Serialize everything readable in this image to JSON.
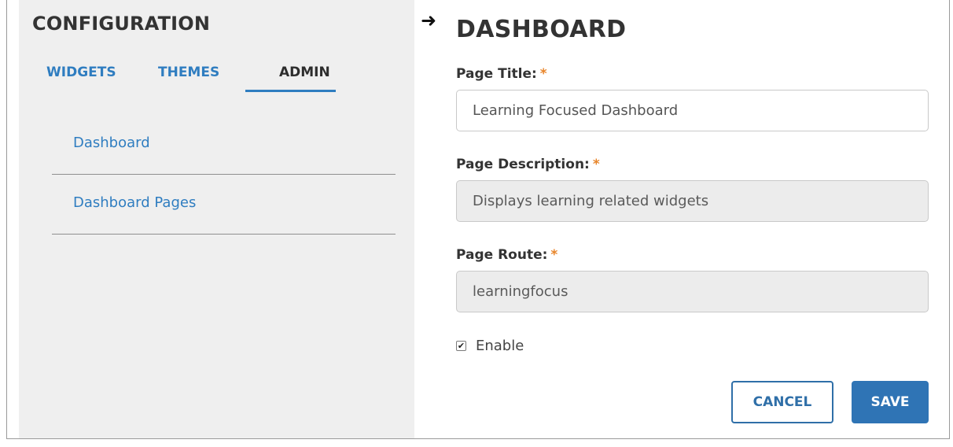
{
  "sidebar": {
    "title": "CONFIGURATION",
    "tabs": [
      {
        "label": "WIDGETS",
        "active": false
      },
      {
        "label": "THEMES",
        "active": false
      },
      {
        "label": "ADMIN",
        "active": true
      }
    ],
    "items": [
      {
        "label": "Dashboard"
      },
      {
        "label": "Dashboard Pages"
      }
    ]
  },
  "main": {
    "arrow_icon": "right-arrow-icon",
    "title": "DASHBOARD",
    "required_marker": "*",
    "fields": {
      "page_title": {
        "label": "Page Title:",
        "value": "Learning Focused Dashboard"
      },
      "page_description": {
        "label": "Page Description:",
        "value": "Displays learning related widgets"
      },
      "page_route": {
        "label": "Page Route:",
        "value": "learningfocus"
      }
    },
    "enable": {
      "label": "Enable",
      "checked": true
    },
    "buttons": {
      "cancel_label": "CANCEL",
      "save_label": "SAVE"
    }
  },
  "colors": {
    "accent": "#2f7dc0",
    "required": "#e8852a",
    "sidebar_bg": "#efefef"
  }
}
